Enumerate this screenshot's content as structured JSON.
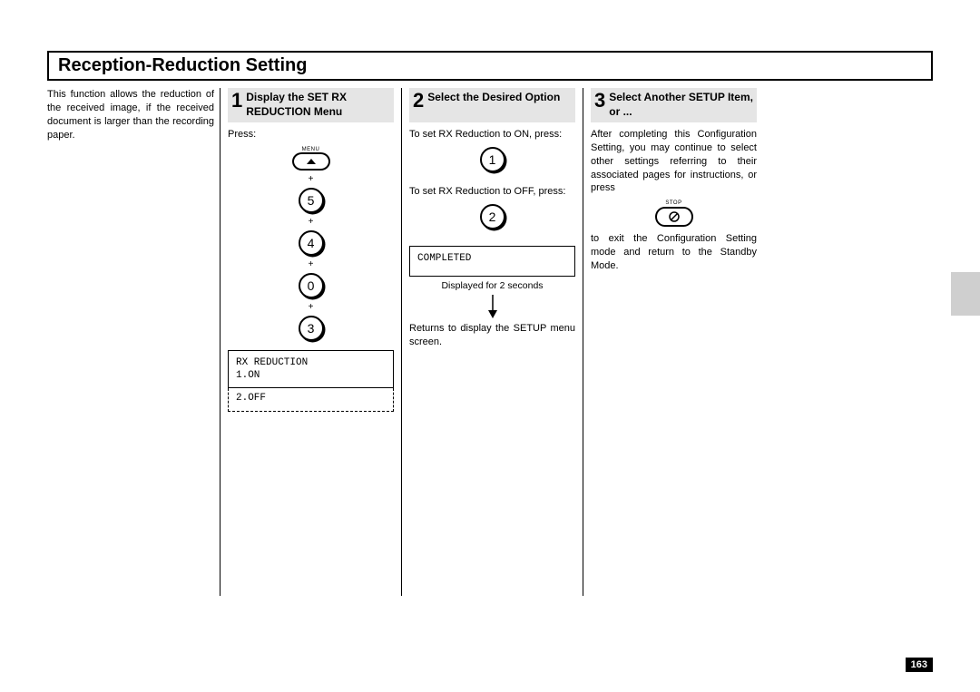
{
  "title": "Reception-Reduction Setting",
  "intro": "This function allows the reduction of the received image, if the received document is larger than the recording paper.",
  "pageNumber": "163",
  "step1": {
    "num": "1",
    "title": "Display the SET RX REDUCTION Menu",
    "press": "Press:",
    "menuLabel": "MENU",
    "plus": "+",
    "k1": "5",
    "k2": "4",
    "k3": "0",
    "k4": "3",
    "lcdLine1": "RX REDUCTION",
    "lcdLine2": "1.ON",
    "lcdLine3": "2.OFF"
  },
  "step2": {
    "num": "2",
    "title": "Select the Desired Option",
    "textOn": "To set RX Reduction to ON, press:",
    "keyOn": "1",
    "textOff": "To set RX Reduction to OFF, press:",
    "keyOff": "2",
    "lcdCompleted": "COMPLETED",
    "caption": "Displayed for 2 seconds",
    "returnText": "Returns to display the SETUP menu screen."
  },
  "step3": {
    "num": "3",
    "title": "Select Another SETUP Item, or ...",
    "text1": "After completing this Configuration Setting, you may continue to select other settings referring to their associated pages for instructions, or press",
    "stopLabel": "STOP",
    "text2": "to exit the Configuration Setting mode and return to the Standby Mode."
  }
}
